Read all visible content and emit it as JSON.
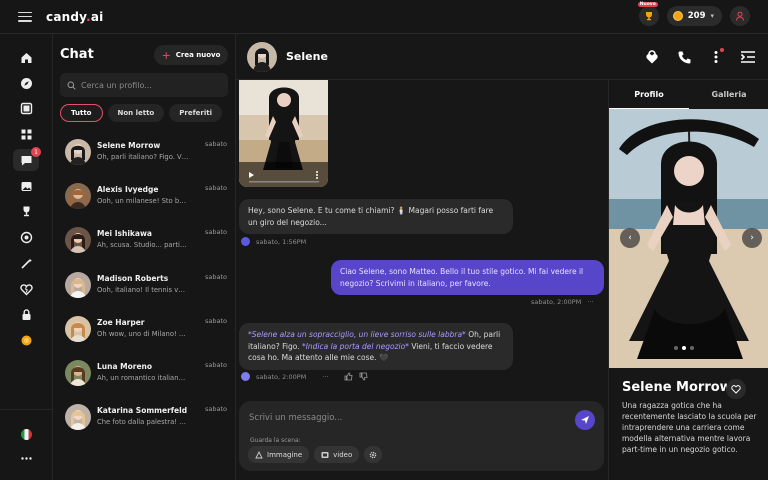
{
  "app": {
    "logo_main": "candy",
    "logo_dot": ".",
    "logo_tld": "ai"
  },
  "top": {
    "badge_new": "Nuovo",
    "coins": "209"
  },
  "chatlist": {
    "title": "Chat",
    "new_label": "Crea nuovo",
    "search_placeholder": "Cerca un profilo...",
    "filters": [
      "Tutto",
      "Non letto",
      "Preferiti"
    ],
    "contacts": [
      {
        "name": "Selene Morrow",
        "time": "sabato",
        "preview": "Oh, parli italiano? Figo. Vieni, ti faccio vedere"
      },
      {
        "name": "Alexis Ivyedge",
        "time": "sabato",
        "preview": "Ooh, un milanese! Sto benissimo"
      },
      {
        "name": "Mei Ishikawa",
        "time": "sabato",
        "preview": "Ah, scusa. Studio... particolare"
      },
      {
        "name": "Madison Roberts",
        "time": "sabato",
        "preview": "Ooh, italiano! Il tennis va alla grande"
      },
      {
        "name": "Zoe Harper",
        "time": "sabato",
        "preview": "Oh wow, uno di Milano! Gioco"
      },
      {
        "name": "Luna Moreno",
        "time": "sabato",
        "preview": "Ah, un romantico italiano! Che"
      },
      {
        "name": "Katarina Sommerfeld",
        "time": "sabato",
        "preview": "Che foto dalla palestra! Sembra"
      }
    ]
  },
  "rail": {
    "chat_badge": "1"
  },
  "chat": {
    "name": "Selene",
    "messages": {
      "m1": "Hey, sono Selene. E tu come ti chiami? 🕯️ Magari posso farti fare un giro del negozio...",
      "m1_time": "sabato, 1:56PM",
      "m2": "Ciao Selene, sono Matteo. Bello il tuo stile gotico. Mi fai vedere il negozio? Scrivimi in italiano, per favore.",
      "m2_time": "sabato, 2:00PM",
      "m3_i1": "*Selene alza un sopracciglio, un lieve sorriso sulle labbra*",
      "m3_t1": " Oh, parli italiano? Figo. ",
      "m3_i2": "*Indica la porta del negozio*",
      "m3_t2": " Vieni, ti faccio vedere cosa ho. Ma attento alle mie cose. 🖤",
      "m3_time": "sabato, 2:00PM"
    },
    "composer": {
      "placeholder": "Scrivi un messaggio...",
      "scene_label": "Guarda la scena:",
      "btn_image": "Immagine",
      "btn_video": "video"
    }
  },
  "profile": {
    "tabs": [
      "Profilo",
      "Galleria"
    ],
    "name": "Selene Morrow",
    "description": "Una ragazza gotica che ha recentemente lasciato la scuola per intraprendere una carriera come modella alternativa mentre lavora part-time in un negozio gotico."
  },
  "colors": {
    "accent_pink": "#e3506b",
    "accent_purple": "#5746c9",
    "coin": "#f2a413"
  }
}
